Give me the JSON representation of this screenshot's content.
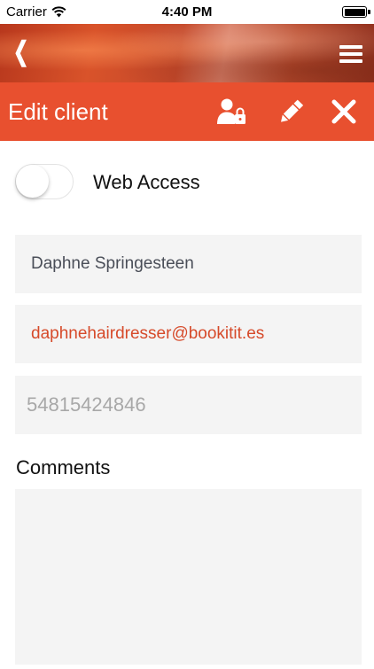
{
  "status_bar": {
    "carrier": "Carrier",
    "time": "4:40 PM"
  },
  "header": {
    "back_glyph": "❮",
    "title": "Edit client",
    "actions": [
      "user-lock-icon",
      "pencil-icon",
      "close-icon"
    ],
    "accent_color": "#e8502f"
  },
  "web_access": {
    "label": "Web Access",
    "enabled": false
  },
  "form": {
    "name_value": "Daphne Springesteen",
    "email_value": "daphnehairdresser@bookitit.es",
    "phone_value": "54815424846"
  },
  "comments": {
    "label": "Comments",
    "value": ""
  }
}
